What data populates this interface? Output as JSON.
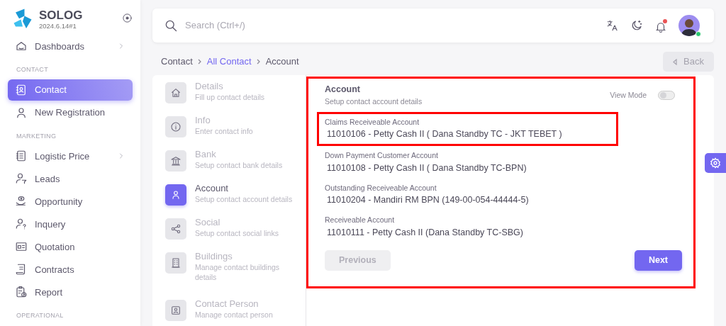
{
  "sidebar": {
    "brand": "SOLOG",
    "version": "2024.6.14#1",
    "groups": [
      {
        "items": [
          {
            "label": "Dashboards",
            "selected": false,
            "submenu": true
          }
        ]
      },
      {
        "title": "CONTACT",
        "items": [
          {
            "label": "Contact",
            "selected": true,
            "submenu": false
          },
          {
            "label": "New Registration",
            "selected": false,
            "submenu": false
          }
        ]
      },
      {
        "title": "MARKETING",
        "items": [
          {
            "label": "Logistic Price",
            "selected": false,
            "submenu": true
          },
          {
            "label": "Leads",
            "selected": false,
            "submenu": false
          },
          {
            "label": "Opportunity",
            "selected": false,
            "submenu": false
          },
          {
            "label": "Inquery",
            "selected": false,
            "submenu": false
          },
          {
            "label": "Quotation",
            "selected": false,
            "submenu": false
          },
          {
            "label": "Contracts",
            "selected": false,
            "submenu": false
          },
          {
            "label": "Report",
            "selected": false,
            "submenu": false
          }
        ]
      },
      {
        "title": "OPERATIONAL"
      }
    ]
  },
  "topbar": {
    "search": {
      "placeholder": "Search (Ctrl+/)"
    },
    "notification_unread": true,
    "user_online": true
  },
  "breadcrumb": [
    {
      "label": "Contact",
      "link": false
    },
    {
      "label": "All Contact",
      "link": true
    },
    {
      "label": "Account",
      "link": false
    }
  ],
  "back_button": {
    "label": "Back",
    "disabled": true
  },
  "steps": [
    {
      "title": "Details",
      "subtitle": "Fill up contact details",
      "selected": false
    },
    {
      "title": "Info",
      "subtitle": "Enter contact info",
      "selected": false
    },
    {
      "title": "Bank",
      "subtitle": "Setup contact bank details",
      "selected": false
    },
    {
      "title": "Account",
      "subtitle": "Setup contact account details",
      "selected": true
    },
    {
      "title": "Social",
      "subtitle": "Setup contact social links",
      "selected": false
    },
    {
      "title": "Buildings",
      "subtitle": "Manage contact buildings details",
      "selected": false
    },
    {
      "title": "Contact Person",
      "subtitle": "Manage contact person",
      "selected": false
    }
  ],
  "panel": {
    "title": "Account",
    "subtitle": "Setup contact account details",
    "highlighted": true,
    "view_mode": {
      "label": "View Mode",
      "on": false
    },
    "fields": [
      {
        "label": "Claims Receiveable Account",
        "value": "11010106 - Petty Cash II ( Dana Standby TC - JKT TEBET )",
        "highlighted": true
      },
      {
        "label": "Down Payment Customer Account",
        "value": "11010108 - Petty Cash II ( Dana Standby TC-BPN)",
        "highlighted": false
      },
      {
        "label": "Outstanding Receiveable Account",
        "value": "11010204 - Mandiri RM BPN (149-00-054-44444-5)",
        "highlighted": false
      },
      {
        "label": "Receiveable Account",
        "value": "11010111 - Petty Cash II (Dana Standby TC-SBG)",
        "highlighted": false
      }
    ],
    "previous_button": {
      "label": "Previous",
      "disabled": true
    },
    "next_button": {
      "label": "Next",
      "disabled": false
    }
  }
}
